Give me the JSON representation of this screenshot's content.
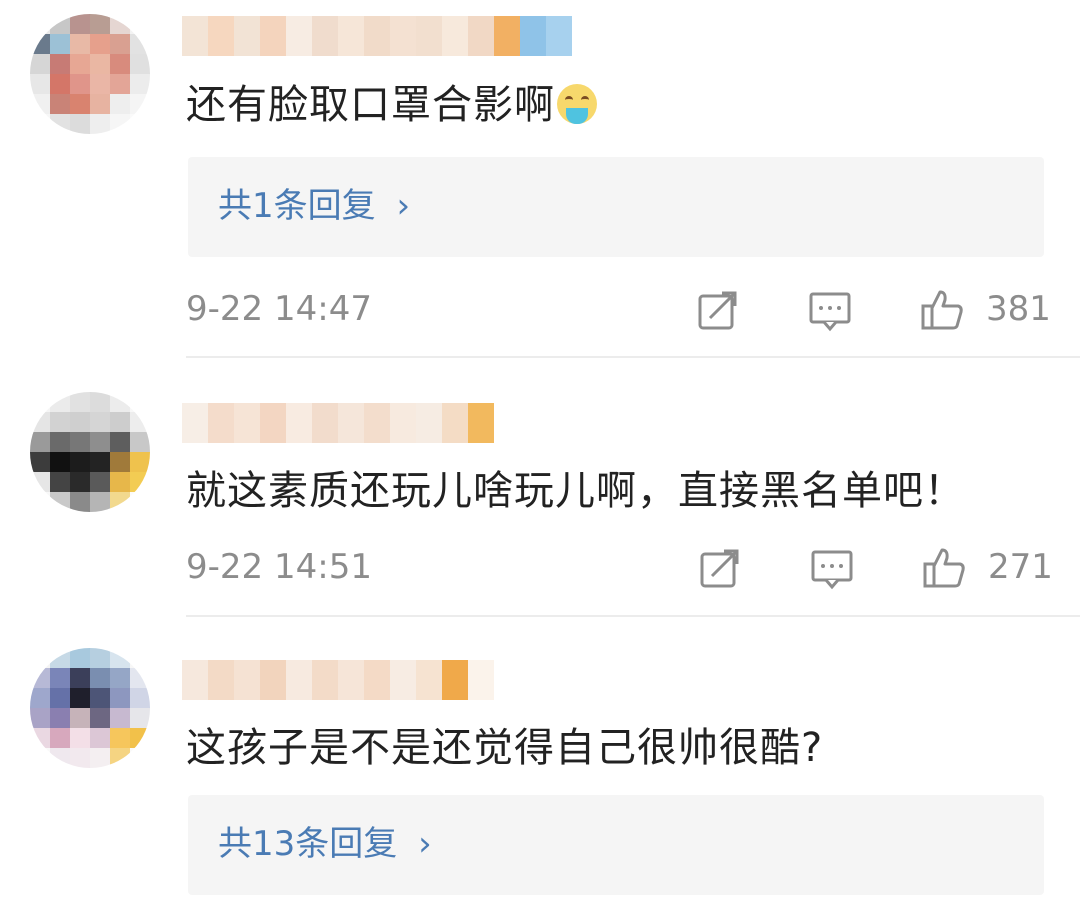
{
  "comments": [
    {
      "text": "还有脸取口罩合影啊",
      "emoji": "puke-emoji",
      "reply_label": "共1条回复",
      "reply_chevron": "›",
      "time": "9-22 14:47",
      "likes": "381"
    },
    {
      "text": "就这素质还玩儿啥玩儿啊，直接黑名单吧！",
      "time": "9-22 14:51",
      "likes": "271"
    },
    {
      "text": "这孩子是不是还觉得自己很帅很酷?",
      "reply_label": "共13条回复",
      "reply_chevron": "›"
    }
  ],
  "colors": {
    "link": "#4a7bb4",
    "meta": "#8c8c8c",
    "reply_bg": "#f5f5f5"
  },
  "icons": [
    "share-icon",
    "comment-icon",
    "like-icon"
  ]
}
